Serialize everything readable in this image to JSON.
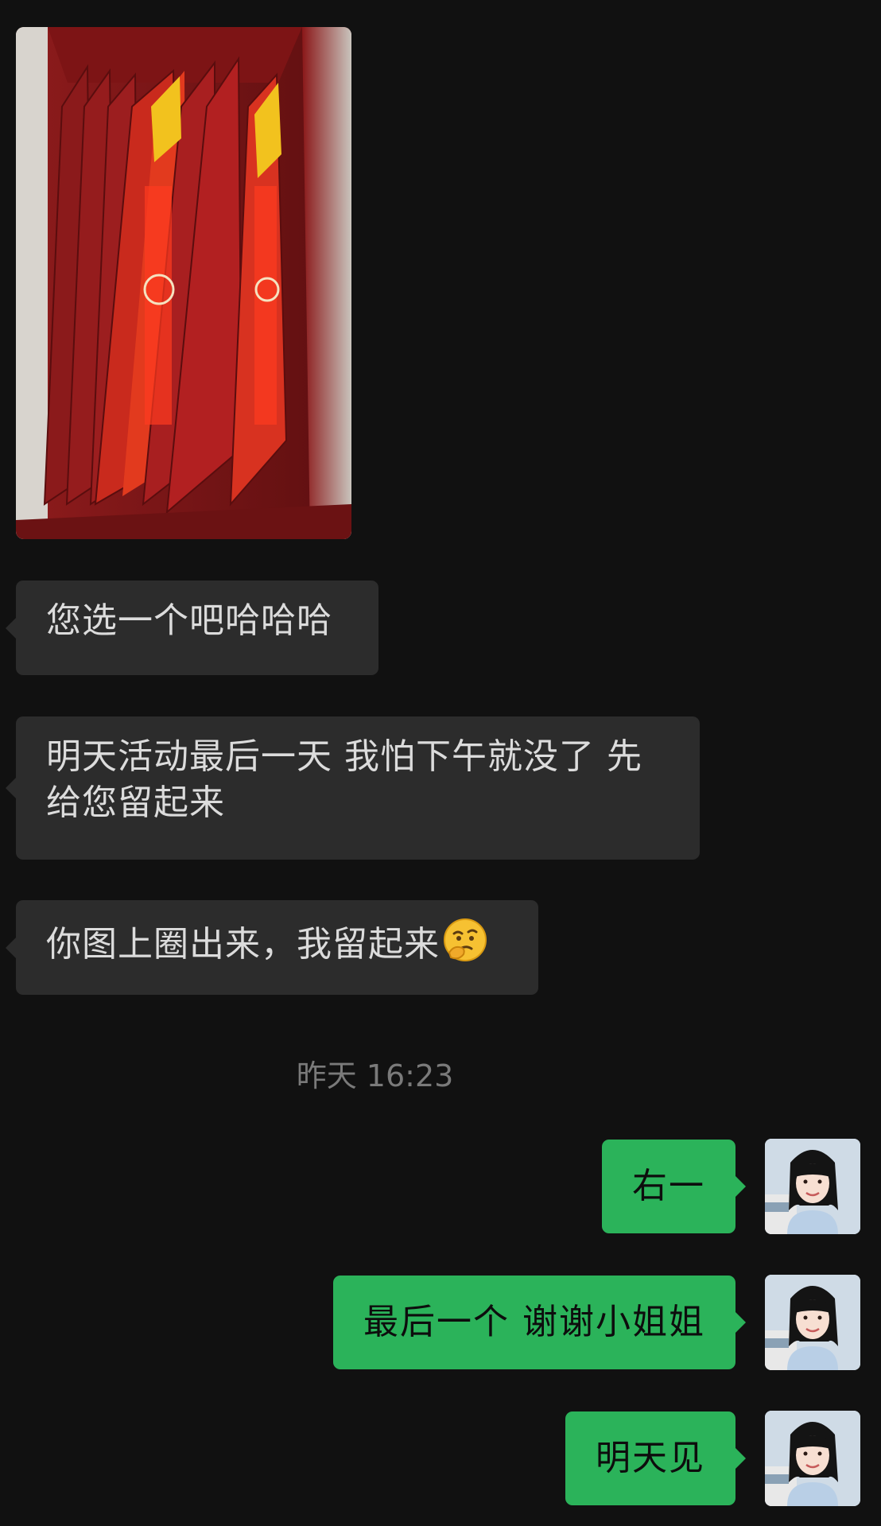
{
  "conversation": {
    "messages": [
      {
        "direction": "in",
        "type": "image",
        "content": "product box photo"
      },
      {
        "direction": "in",
        "type": "text",
        "text": "您选一个吧哈哈哈"
      },
      {
        "direction": "in",
        "type": "text",
        "text": "明天活动最后一天 我怕下午就没了 先给您留起来"
      },
      {
        "direction": "in",
        "type": "text",
        "text": "你图上圈出来，我留起来",
        "emoji": "thinking-face-icon"
      },
      {
        "direction": "out",
        "type": "text",
        "text": "右一"
      },
      {
        "direction": "out",
        "type": "text",
        "text": "最后一个 谢谢小姐姐"
      },
      {
        "direction": "out",
        "type": "text",
        "text": "明天见"
      }
    ],
    "timestamp": "昨天 16:23"
  },
  "colors": {
    "background": "#111111",
    "incoming_bubble": "#2c2c2c",
    "outgoing_bubble": "#2bb35a",
    "timestamp_text": "#7a7a7a"
  }
}
